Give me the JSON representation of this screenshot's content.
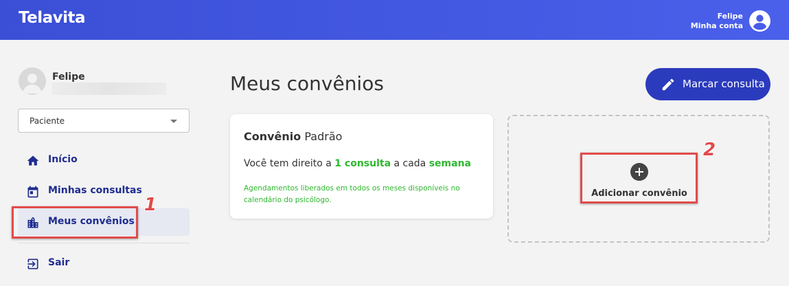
{
  "header": {
    "logo": "Telavita",
    "user_name": "Felipe",
    "account_label": "Minha conta"
  },
  "sidebar": {
    "user_name": "Felipe",
    "role_select": "Paciente",
    "items": [
      {
        "label": "Início",
        "icon": "home-icon"
      },
      {
        "label": "Minhas consultas",
        "icon": "calendar-icon"
      },
      {
        "label": "Meus convênios",
        "icon": "building-icon",
        "active": true
      },
      {
        "label": "Sair",
        "icon": "logout-icon"
      }
    ]
  },
  "main": {
    "title": "Meus convênios",
    "book_button": "Marcar consulta",
    "card": {
      "title_bold": "Convênio",
      "title_rest": "Padrão",
      "line_prefix": "Você tem direito a",
      "line_amount": "1 consulta",
      "line_middle": "a cada",
      "line_period": "semana",
      "note": "Agendamentos liberados em todos os meses disponíveis no calendário do psicólogo."
    },
    "add_label": "Adicionar convênio"
  },
  "annotations": {
    "marker_1": "1",
    "marker_2": "2"
  },
  "colors": {
    "header": "#4052e0",
    "primary_button": "#2b3bbd",
    "nav_text": "#1f2d8f",
    "green": "#2eb82e",
    "highlight": "#e24b4b"
  }
}
